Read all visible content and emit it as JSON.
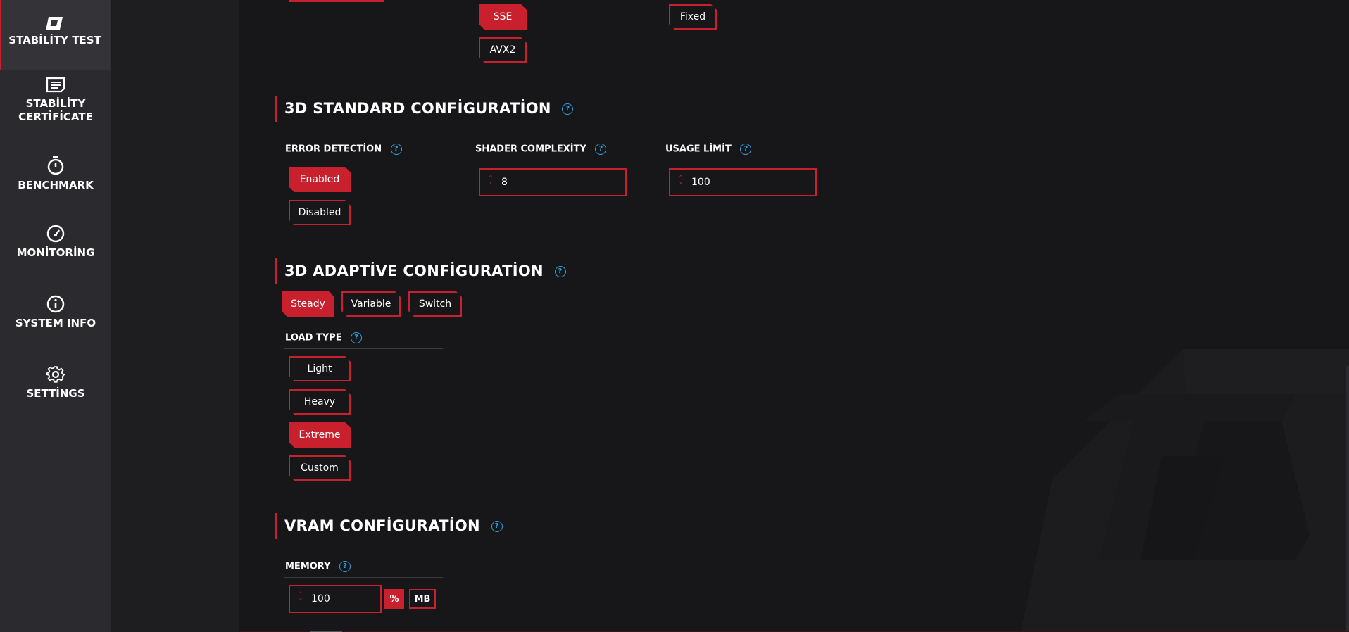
{
  "sidebar": {
    "items": [
      {
        "label": "STABİLİTY TEST",
        "icon": "logo-icon"
      },
      {
        "label": "STABİLİTY CERTİFİCATE",
        "icon": "certificate-icon"
      },
      {
        "label": "BENCHMARK",
        "icon": "stopwatch-icon"
      },
      {
        "label": "MONİTORİNG",
        "icon": "gauge-icon"
      },
      {
        "label": "SYSTEM INFO",
        "icon": "info-icon"
      },
      {
        "label": "SETTİNGS",
        "icon": "gear-icon"
      }
    ]
  },
  "top": {
    "sse": "SSE",
    "avx2": "AVX2",
    "fixed": "Fixed"
  },
  "standard": {
    "title": "3D STANDARD CONFİGURATİON",
    "error_detection": {
      "label": "ERROR DETECTİON",
      "enabled": "Enabled",
      "disabled": "Disabled"
    },
    "shader": {
      "label": "SHADER COMPLEXİTY",
      "value": "8"
    },
    "usage": {
      "label": "USAGE LİMİT",
      "value": "100"
    }
  },
  "adaptive": {
    "title": "3D ADAPTİVE CONFİGURATİON",
    "modes": [
      "Steady",
      "Variable",
      "Switch"
    ],
    "load_type": {
      "label": "LOAD TYPE",
      "options": [
        "Light",
        "Heavy",
        "Extreme",
        "Custom"
      ]
    }
  },
  "vram": {
    "title": "VRAM CONFİGURATİON",
    "memory": {
      "label": "MEMORY",
      "value": "100",
      "unit_percent": "%",
      "unit_mb": "MB"
    }
  },
  "colors": {
    "accent": "#c8202d",
    "help": "#2aa3e0",
    "sidebar": "#2b2b2f",
    "background": "#17171a"
  }
}
